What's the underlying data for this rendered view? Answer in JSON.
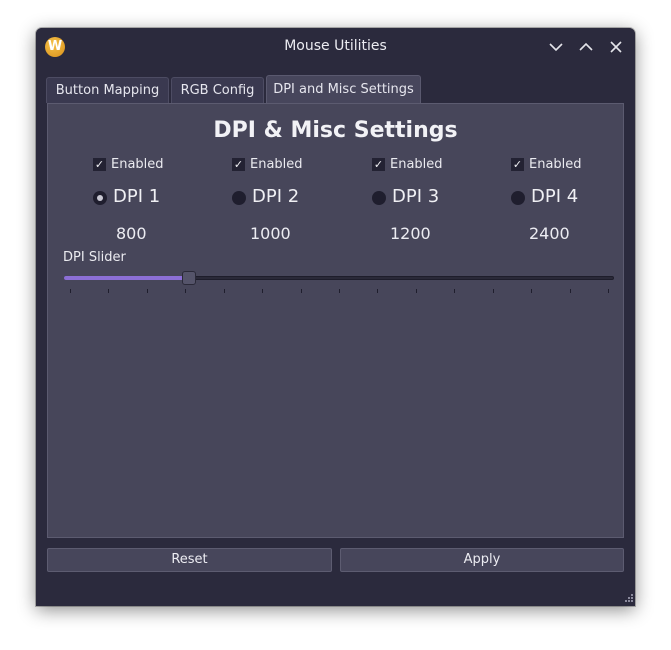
{
  "window": {
    "title": "Mouse Utilities",
    "app_icon_letter": "W",
    "controls": [
      "minimize",
      "maximize",
      "close"
    ]
  },
  "tabs": [
    {
      "label": "Button Mapping",
      "active": false
    },
    {
      "label": "RGB Config",
      "active": false
    },
    {
      "label": "DPI and Misc Settings",
      "active": true
    }
  ],
  "panel": {
    "heading": "DPI & Misc Settings",
    "dpi_profiles": [
      {
        "enabled_label": "Enabled",
        "enabled": true,
        "name": "DPI 1",
        "selected": true,
        "value": "800"
      },
      {
        "enabled_label": "Enabled",
        "enabled": true,
        "name": "DPI 2",
        "selected": false,
        "value": "1000"
      },
      {
        "enabled_label": "Enabled",
        "enabled": true,
        "name": "DPI 3",
        "selected": false,
        "value": "1200"
      },
      {
        "enabled_label": "Enabled",
        "enabled": true,
        "name": "DPI 4",
        "selected": false,
        "value": "2400"
      }
    ],
    "slider": {
      "label": "DPI Slider",
      "position_fraction": 0.22,
      "tick_count": 15,
      "fill_color": "#8c6fd6"
    }
  },
  "buttons": {
    "reset": "Reset",
    "apply": "Apply"
  },
  "check_glyph": "✓"
}
